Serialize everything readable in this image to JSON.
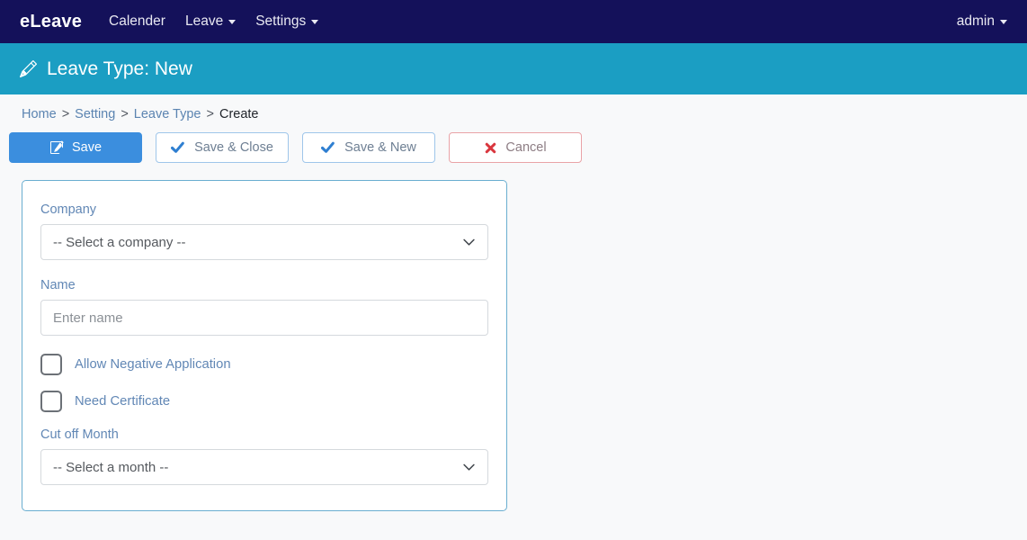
{
  "navbar": {
    "brand": "eLeave",
    "links": [
      {
        "label": "Calender",
        "has_caret": false
      },
      {
        "label": "Leave",
        "has_caret": true
      },
      {
        "label": "Settings",
        "has_caret": true
      }
    ],
    "user": "admin",
    "background_color": "#14115a"
  },
  "page_header": {
    "icon": "pencil-icon",
    "title": "Leave Type: New",
    "background_color": "#1b9ec3"
  },
  "breadcrumb": {
    "items": [
      "Home",
      "Setting",
      "Leave Type",
      "Create"
    ],
    "separator": ">"
  },
  "toolbar": {
    "buttons": [
      {
        "label": "Save",
        "icon": "edit-square-icon",
        "style": "primary",
        "color": "#3b8ede"
      },
      {
        "label": "Save & Close",
        "icon": "check-icon",
        "style": "outline",
        "color": "#2f7fd1"
      },
      {
        "label": "Save & New",
        "icon": "check-icon",
        "style": "outline",
        "color": "#2f7fd1"
      },
      {
        "label": "Cancel",
        "icon": "x-icon",
        "style": "danger",
        "color": "#d9363e"
      }
    ]
  },
  "form": {
    "company": {
      "label": "Company",
      "selected": "-- Select a company --"
    },
    "name": {
      "label": "Name",
      "value": "",
      "placeholder": "Enter name"
    },
    "allow_negative": {
      "label": "Allow Negative Application",
      "checked": false
    },
    "need_certificate": {
      "label": "Need Certificate",
      "checked": false
    },
    "cut_off_month": {
      "label": "Cut off Month",
      "selected": "-- Select a month --"
    }
  }
}
